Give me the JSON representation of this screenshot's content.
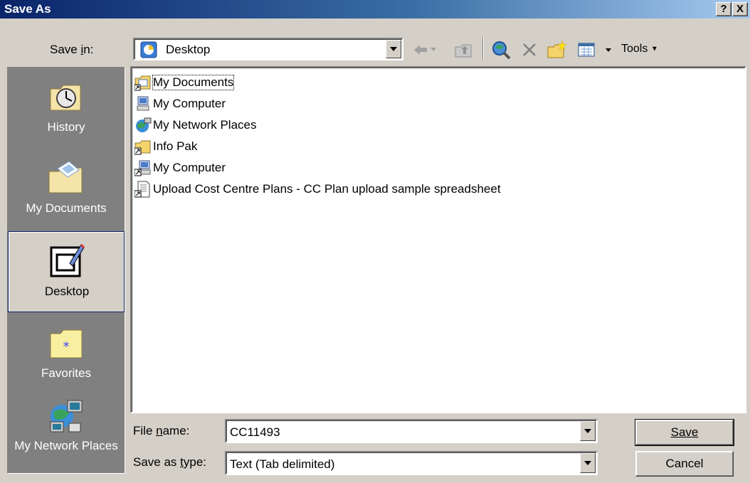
{
  "window": {
    "title": "Save As",
    "help_glyph": "?",
    "close_glyph": "X"
  },
  "toolbar": {
    "save_in_label": "Save in:",
    "save_in_value": "Desktop",
    "tools_label": "Tools"
  },
  "places": [
    {
      "label": "History"
    },
    {
      "label": "My Documents"
    },
    {
      "label": "Desktop"
    },
    {
      "label": "Favorites"
    },
    {
      "label": "My Network Places"
    }
  ],
  "files": [
    {
      "label": "My Documents",
      "icon": "my-documents-icon"
    },
    {
      "label": "My Computer",
      "icon": "my-computer-icon"
    },
    {
      "label": "My Network Places",
      "icon": "network-places-icon"
    },
    {
      "label": "Info Pak",
      "icon": "folder-shortcut-icon"
    },
    {
      "label": "My Computer",
      "icon": "computer-shortcut-icon"
    },
    {
      "label": "Upload Cost Centre Plans - CC Plan upload sample spreadsheet",
      "icon": "document-shortcut-icon"
    }
  ],
  "form": {
    "file_name_label": "File name:",
    "file_name_value": "CC11493",
    "type_label": "Save as type:",
    "type_value": "Text (Tab delimited)",
    "save_label": "Save",
    "cancel_label": "Cancel"
  }
}
